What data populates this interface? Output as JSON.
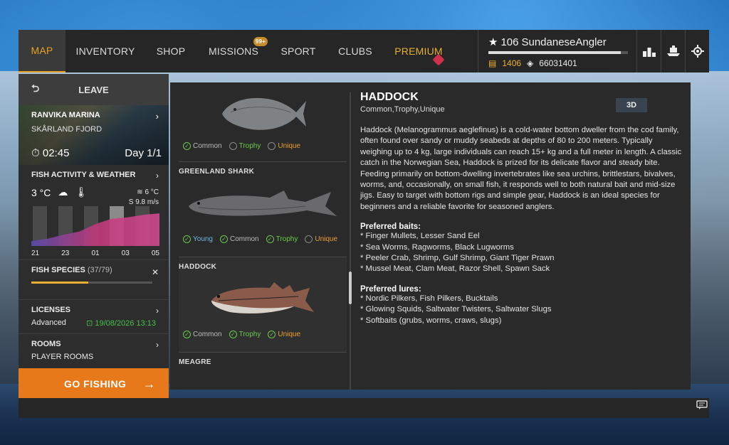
{
  "nav": {
    "tabs": [
      {
        "label": "MAP",
        "active": true
      },
      {
        "label": "INVENTORY"
      },
      {
        "label": "SHOP"
      },
      {
        "label": "MISSIONS",
        "badge": "99+"
      },
      {
        "label": "SPORT"
      },
      {
        "label": "CLUBS"
      },
      {
        "label": "PREMIUM"
      }
    ]
  },
  "player": {
    "level": "106",
    "name": "SundaneseAngler",
    "xp_progress": 0.95,
    "gold": "1406",
    "silver": "66031401"
  },
  "top_icons": [
    "leaderboard-icon",
    "tournament-icon",
    "settings-icon"
  ],
  "sidebar": {
    "leave": "LEAVE",
    "location": {
      "name": "RANVIKA MARINA",
      "region": "SKÅRLAND FJORD",
      "time": "02:45",
      "day": "Day 1/1"
    },
    "weather": {
      "title": "FISH ACTIVITY & WEATHER",
      "air_temp": "3 °C",
      "water_temp": "6 °C",
      "wind": "S 9.8 m/s",
      "hours": [
        "21",
        "23",
        "01",
        "03",
        "05"
      ],
      "activity": [
        0.12,
        0.18,
        0.28,
        0.36,
        0.55,
        0.68,
        0.72,
        0.78,
        0.82
      ]
    },
    "species": {
      "title": "FISH SPECIES",
      "count": "(37/79)",
      "progress": 0.47
    },
    "licenses": {
      "title": "LICENSES",
      "type": "Advanced",
      "expires": "19/08/2026 13:13"
    },
    "rooms": {
      "title": "ROOMS",
      "sub": "PLAYER ROOMS"
    },
    "go_fishing": "GO FISHING"
  },
  "fish_list": [
    {
      "name": "",
      "tags": [
        {
          "label": "Common",
          "on": true,
          "kind": "common"
        },
        {
          "label": "Trophy",
          "on": false,
          "kind": "trophy"
        },
        {
          "label": "Unique",
          "on": false,
          "kind": "unique"
        }
      ]
    },
    {
      "name": "GREENLAND SHARK",
      "tags": [
        {
          "label": "Young",
          "on": true,
          "kind": "young"
        },
        {
          "label": "Common",
          "on": true,
          "kind": "common"
        },
        {
          "label": "Trophy",
          "on": true,
          "kind": "trophy"
        },
        {
          "label": "Unique",
          "on": false,
          "kind": "unique"
        }
      ]
    },
    {
      "name": "HADDOCK",
      "tags": [
        {
          "label": "Common",
          "on": true,
          "kind": "common"
        },
        {
          "label": "Trophy",
          "on": true,
          "kind": "trophy"
        },
        {
          "label": "Unique",
          "on": true,
          "kind": "unique"
        }
      ]
    },
    {
      "name": "MEAGRE",
      "tags": []
    }
  ],
  "detail": {
    "title": "HADDOCK",
    "categories": "Common,Trophy,Unique",
    "btn_3d": "3D",
    "description": "Haddock (Melanogrammus aeglefinus) is a cold-water bottom dweller from the cod family, often found over sandy or muddy seabeds at depths of 80 to 200 meters. Typically weighing up to 4 kg, large individuals can reach 15+ kg and a full meter in length. A classic catch in the Norwegian Sea, Haddock is prized for its delicate flavor and steady bite. Feeding primarily on bottom-dwelling invertebrates like sea urchins, brittlestars, bivalves, worms, and, occasionally, on small fish, it responds well to both natural bait and mid-size jigs. Easy to target with bottom rigs and simple gear, Haddock is an ideal species for beginners and a reliable favorite for seasoned anglers.",
    "baits_title": "Preferred baits:",
    "baits": [
      "* Finger Mullets, Lesser Sand Eel",
      "* Sea Worms, Ragworms, Black Lugworms",
      "* Peeler Crab, Shrimp, Gulf Shrimp, Giant Tiger Prawn",
      "* Mussel Meat, Clam Meat, Razor Shell, Spawn Sack"
    ],
    "lures_title": "Preferred lures:",
    "lures": [
      "* Nordic Pilkers, Fish Pilkers, Bucktails",
      "* Glowing Squids, Saltwater Twisters, Saltwater Slugs",
      "* Softbaits (grubs, worms, craws, slugs)"
    ]
  },
  "colors": {
    "accent": "#e8a020",
    "go": "#e8791a",
    "trophy": "#6cc94c",
    "unique": "#e8a030",
    "young": "#6ab6d8"
  }
}
